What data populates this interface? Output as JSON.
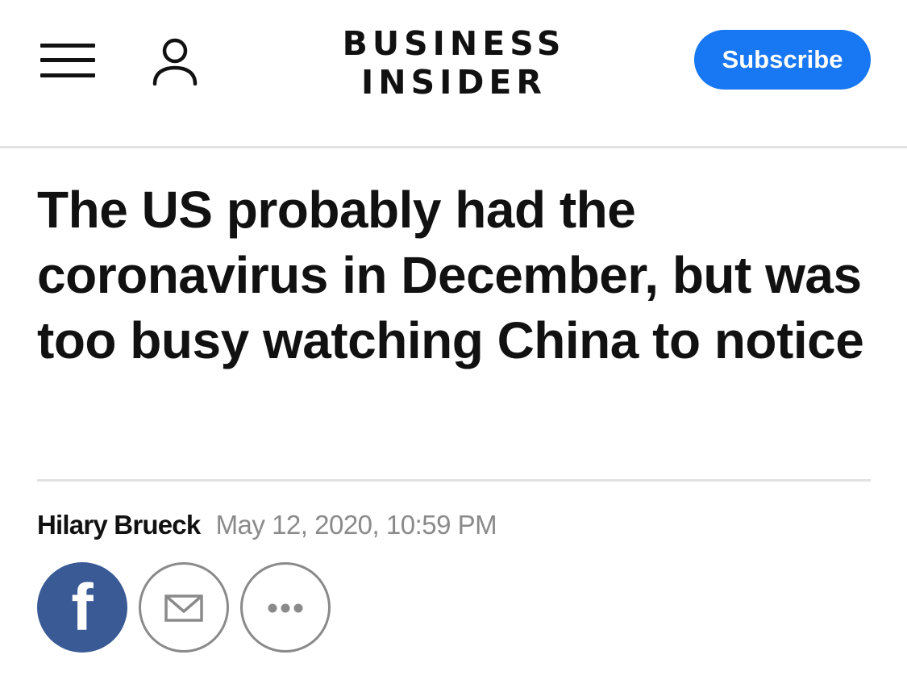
{
  "header": {
    "brand_line1": "BUSINESS",
    "brand_line2": "INSIDER",
    "subscribe_label": "Subscribe",
    "accent_color": "#1877f2"
  },
  "article": {
    "headline": "The US probably had the coronavirus in December, but was too busy watching China to notice",
    "author": "Hilary Brueck",
    "date": "May 12, 2020, 10:59 PM"
  },
  "share": {
    "facebook_glyph": "f",
    "facebook_color": "#3a5a96",
    "icons": [
      "facebook-icon",
      "mail-icon",
      "more-icon"
    ]
  }
}
